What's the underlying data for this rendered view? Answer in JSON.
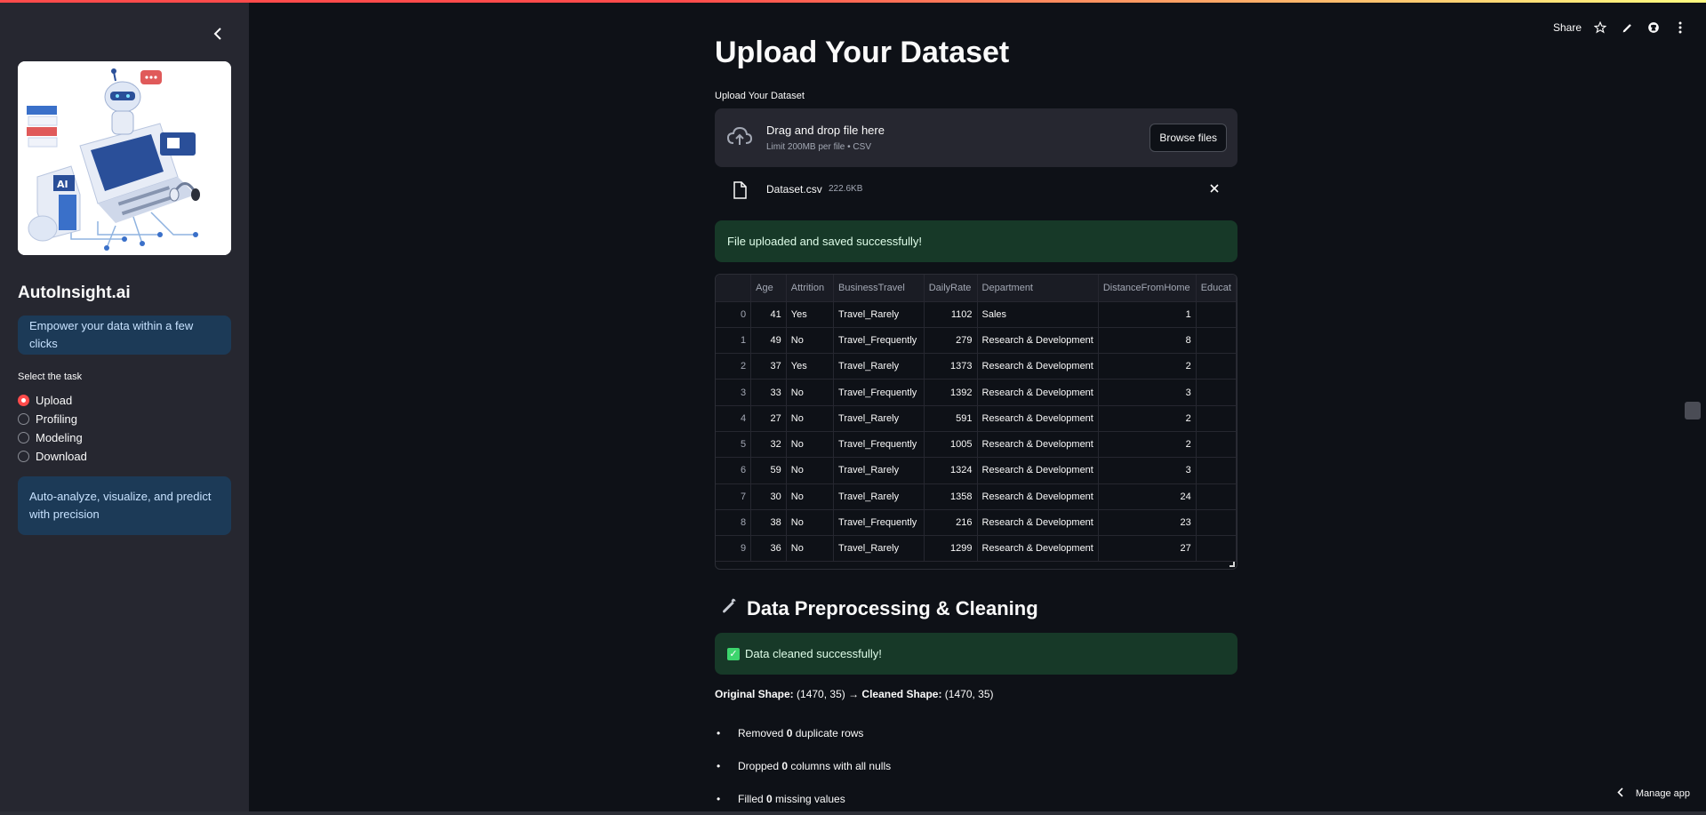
{
  "sidebar": {
    "app_title": "AutoInsight.ai",
    "tagline": "Empower your data within a few clicks",
    "radio_label": "Select the task",
    "tasks": [
      "Upload",
      "Profiling",
      "Modeling",
      "Download"
    ],
    "selected_task": "Upload",
    "description": "Auto-analyze, visualize, and predict with precision"
  },
  "toolbar": {
    "share_label": "Share"
  },
  "main": {
    "title": "Upload Your Dataset",
    "uploader_label": "Upload Your Dataset",
    "dropzone_title": "Drag and drop file here",
    "dropzone_sub": "Limit 200MB per file • CSV",
    "browse_label": "Browse files",
    "file_name": "Dataset.csv",
    "file_size": "222.6KB",
    "upload_success": "File uploaded and saved successfully!",
    "table": {
      "columns": [
        "",
        "Age",
        "Attrition",
        "BusinessTravel",
        "DailyRate",
        "Department",
        "DistanceFromHome",
        "Educat"
      ],
      "rows": [
        [
          "0",
          "41",
          "Yes",
          "Travel_Rarely",
          "1102",
          "Sales",
          "1",
          ""
        ],
        [
          "1",
          "49",
          "No",
          "Travel_Frequently",
          "279",
          "Research & Development",
          "8",
          ""
        ],
        [
          "2",
          "37",
          "Yes",
          "Travel_Rarely",
          "1373",
          "Research & Development",
          "2",
          ""
        ],
        [
          "3",
          "33",
          "No",
          "Travel_Frequently",
          "1392",
          "Research & Development",
          "3",
          ""
        ],
        [
          "4",
          "27",
          "No",
          "Travel_Rarely",
          "591",
          "Research & Development",
          "2",
          ""
        ],
        [
          "5",
          "32",
          "No",
          "Travel_Frequently",
          "1005",
          "Research & Development",
          "2",
          ""
        ],
        [
          "6",
          "59",
          "No",
          "Travel_Rarely",
          "1324",
          "Research & Development",
          "3",
          ""
        ],
        [
          "7",
          "30",
          "No",
          "Travel_Rarely",
          "1358",
          "Research & Development",
          "24",
          ""
        ],
        [
          "8",
          "38",
          "No",
          "Travel_Frequently",
          "216",
          "Research & Development",
          "23",
          ""
        ],
        [
          "9",
          "36",
          "No",
          "Travel_Rarely",
          "1299",
          "Research & Development",
          "27",
          ""
        ]
      ]
    },
    "section_title": "Data Preprocessing & Cleaning",
    "clean_success": "Data cleaned successfully!",
    "shape": {
      "original_label": "Original Shape:",
      "original_value": "(1470, 35)",
      "arrow": "→",
      "cleaned_label": "Cleaned Shape:",
      "cleaned_value": "(1470, 35)"
    },
    "bullets": [
      {
        "pre": "Removed ",
        "num": "0",
        "post": " duplicate rows"
      },
      {
        "pre": "Dropped ",
        "num": "0",
        "post": " columns with all nulls"
      },
      {
        "pre": "Filled ",
        "num": "0",
        "post": " missing values"
      }
    ]
  },
  "footer": {
    "manage_app": "Manage app"
  },
  "colors": {
    "accent": "#ff4b4b",
    "success_bg": "#173928",
    "info_bg": "#1c3a57",
    "sidebar_bg": "#262730",
    "page_bg": "#0e1117"
  }
}
